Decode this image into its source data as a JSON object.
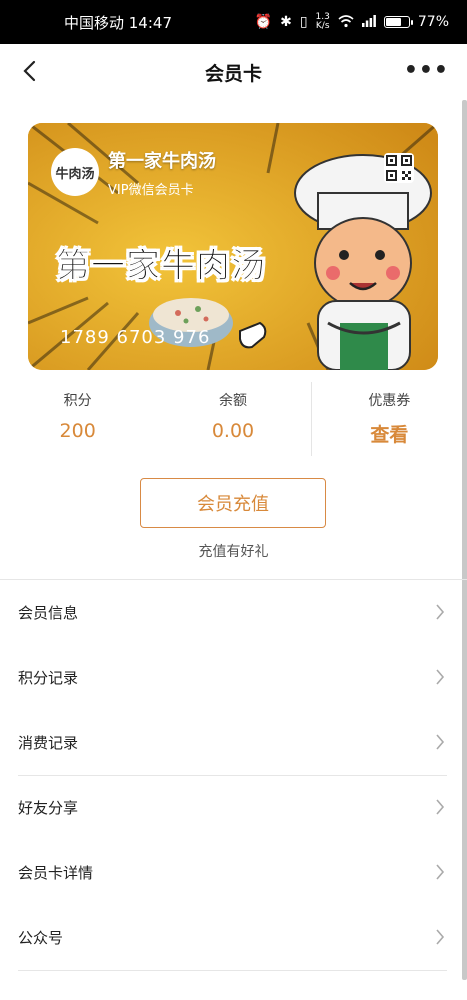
{
  "status_bar": {
    "carrier_time": "中国移动 14:47",
    "net_speed_value": "1.3",
    "net_speed_unit": "K/s",
    "battery": "77%",
    "battery_level": 0.77
  },
  "nav": {
    "title": "会员卡",
    "more": "•••"
  },
  "card": {
    "store_name": "第一家牛肉汤",
    "subtitle": "VIP微信会员卡",
    "banner_text": "第一家牛肉汤",
    "card_number": "1789 6703 976",
    "logo_text": "牛肉汤"
  },
  "stats": {
    "points_label": "积分",
    "points_value": "200",
    "balance_label": "余额",
    "balance_value": "0.00",
    "coupon_label": "优惠券",
    "coupon_value": "查看"
  },
  "recharge": {
    "button_label": "会员充值",
    "tip": "充值有好礼"
  },
  "menu": {
    "items": [
      {
        "label": "会员信息"
      },
      {
        "label": "积分记录"
      },
      {
        "label": "消费记录"
      },
      {
        "label": "好友分享"
      },
      {
        "label": "会员卡详情"
      },
      {
        "label": "公众号"
      }
    ]
  },
  "colors": {
    "accent": "#d8893a",
    "card_bg": "#e5a523"
  }
}
